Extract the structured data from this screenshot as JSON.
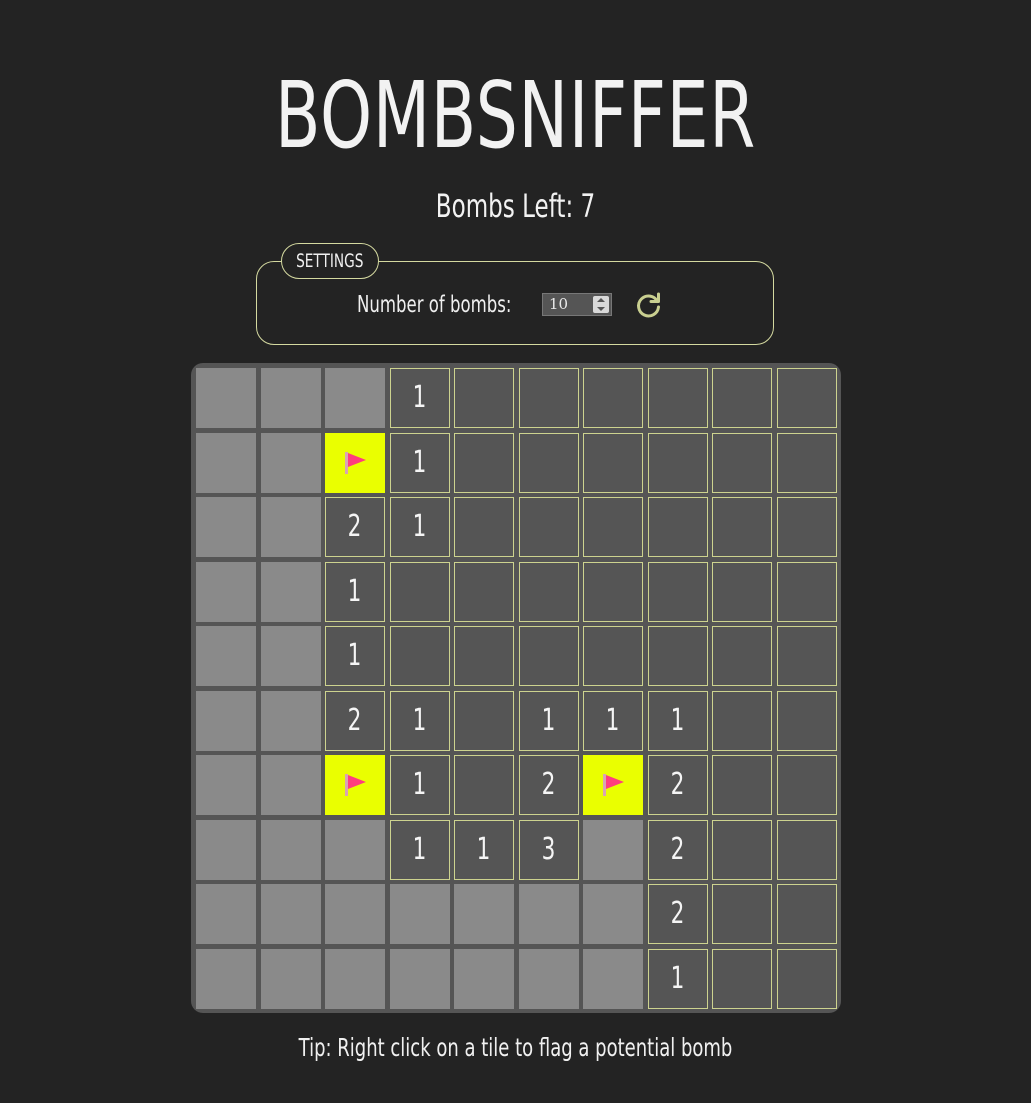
{
  "header": {
    "title": "BOMBSNIFFER",
    "bombs_left": "Bombs Left: 7"
  },
  "settings": {
    "legend": "SETTINGS",
    "bombs_label": "Number of bombs:",
    "bombs_value": "10",
    "reset_icon": "refresh-icon"
  },
  "board": {
    "rows": 10,
    "cols": 10,
    "grid": [
      [
        "h",
        "h",
        "h",
        "1",
        "o",
        "o",
        "o",
        "o",
        "o",
        "o"
      ],
      [
        "h",
        "h",
        "F",
        "1",
        "o",
        "o",
        "o",
        "o",
        "o",
        "o"
      ],
      [
        "h",
        "h",
        "2",
        "1",
        "o",
        "o",
        "o",
        "o",
        "o",
        "o"
      ],
      [
        "h",
        "h",
        "1",
        "o",
        "o",
        "o",
        "o",
        "o",
        "o",
        "o"
      ],
      [
        "h",
        "h",
        "1",
        "o",
        "o",
        "o",
        "o",
        "o",
        "o",
        "o"
      ],
      [
        "h",
        "h",
        "2",
        "1",
        "o",
        "1",
        "1",
        "1",
        "o",
        "o"
      ],
      [
        "h",
        "h",
        "F",
        "1",
        "o",
        "2",
        "F",
        "2",
        "o",
        "o"
      ],
      [
        "h",
        "h",
        "h",
        "1",
        "1",
        "3",
        "h",
        "2",
        "o",
        "o"
      ],
      [
        "h",
        "h",
        "h",
        "h",
        "h",
        "h",
        "h",
        "2",
        "o",
        "o"
      ],
      [
        "h",
        "h",
        "h",
        "h",
        "h",
        "h",
        "h",
        "1",
        "o",
        "o"
      ]
    ],
    "legend": {
      "h": "hidden tile",
      "o": "opened empty tile",
      "F": "flagged tile",
      "digit": "opened tile showing adjacent bomb count"
    }
  },
  "tip": "Tip: Right click on a tile to flag a potential bomb",
  "colors": {
    "background": "#232323",
    "board": "#555555",
    "hidden_tile": "#8a8a8a",
    "open_border": "#cdd38f",
    "flag_tile": "#eaff00",
    "flag": "#ff3d7f",
    "accent": "#d4d9a0"
  }
}
